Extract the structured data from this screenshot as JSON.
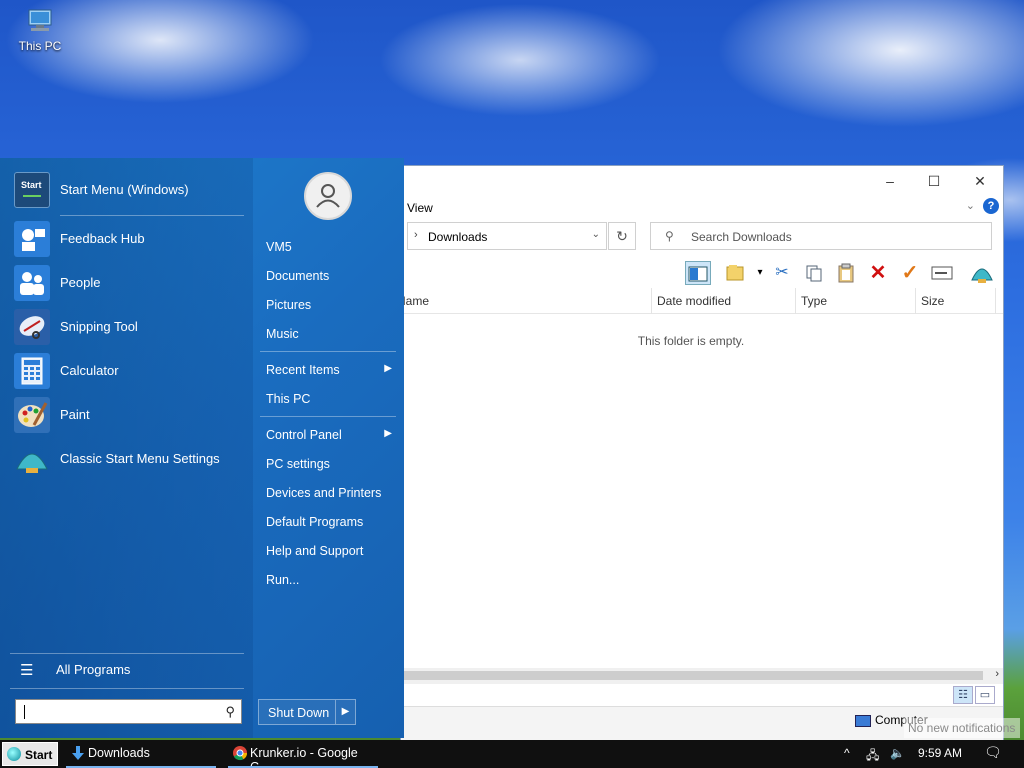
{
  "desktop": {
    "icons": [
      {
        "label": "This PC"
      }
    ]
  },
  "explorer": {
    "menu": {
      "view": "View"
    },
    "address": {
      "path": "Downloads"
    },
    "search": {
      "placeholder": "Search Downloads"
    },
    "columns": [
      "Name",
      "Date modified",
      "Type",
      "Size"
    ],
    "empty_message": "This folder is empty.",
    "status": {
      "location": "Computer"
    },
    "notification": "No new notifications"
  },
  "start_menu": {
    "pinned": [
      {
        "label": "Start Menu (Windows)",
        "icon": "start-menu-icon"
      },
      {
        "label": "Feedback Hub",
        "icon": "feedback-hub-icon"
      },
      {
        "label": "People",
        "icon": "people-icon"
      },
      {
        "label": "Snipping Tool",
        "icon": "snipping-tool-icon"
      },
      {
        "label": "Calculator",
        "icon": "calculator-icon"
      },
      {
        "label": "Paint",
        "icon": "paint-icon"
      },
      {
        "label": "Classic Start Menu Settings",
        "icon": "shell-icon"
      }
    ],
    "start_icon_text": "Start",
    "all_programs": "All Programs",
    "right": {
      "user": "VM5",
      "documents": "Documents",
      "pictures": "Pictures",
      "music": "Music",
      "recent_items": "Recent Items",
      "this_pc": "This PC",
      "control_panel": "Control Panel",
      "pc_settings": "PC settings",
      "devices_printers": "Devices and Printers",
      "default_programs": "Default Programs",
      "help_support": "Help and Support",
      "run": "Run..."
    },
    "shutdown": "Shut Down"
  },
  "taskbar": {
    "start": "Start",
    "tasks": [
      {
        "label": "Downloads",
        "icon": "download-arrow-icon"
      },
      {
        "label": "Krunker.io - Google C...",
        "icon": "chrome-icon"
      }
    ],
    "clock": "9:59 AM"
  },
  "colors": {
    "start_menu_blue": "#1a6cbf",
    "taskbar": "#101010",
    "help_blue": "#1a66d1"
  }
}
